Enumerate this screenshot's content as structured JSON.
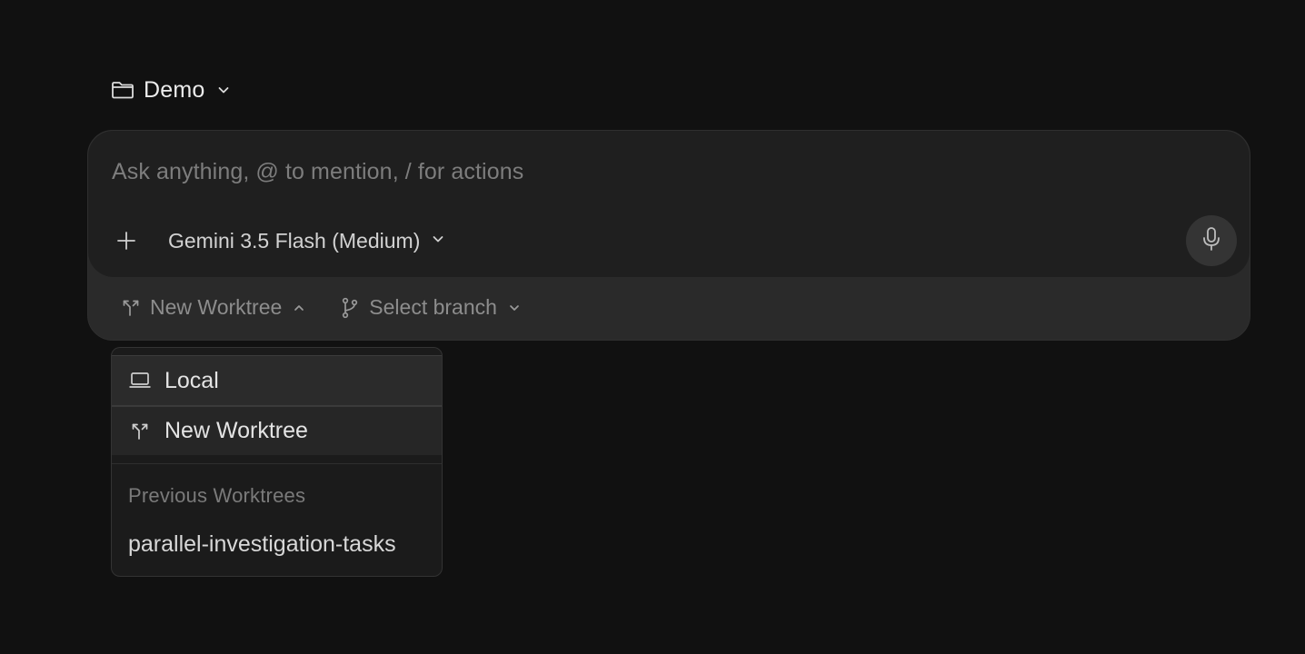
{
  "project": {
    "name": "Demo",
    "folder_icon": "folder-icon",
    "chevron_icon": "chevron-down-icon"
  },
  "composer": {
    "placeholder": "Ask anything, @ to mention, / for actions",
    "add_icon": "plus-icon",
    "model_label": "Gemini 3.5 Flash (Medium)",
    "model_chevron_icon": "chevron-down-icon",
    "mic_icon": "microphone-icon"
  },
  "workspace_bar": {
    "worktree_label": "New Worktree",
    "worktree_icon": "worktree-icon",
    "worktree_chevron_icon": "chevron-up-icon",
    "branch_label": "Select branch",
    "branch_icon": "git-branch-icon",
    "branch_chevron_icon": "chevron-down-icon"
  },
  "worktree_menu": {
    "items": [
      {
        "label": "Local",
        "icon": "laptop-icon"
      },
      {
        "label": "New Worktree",
        "icon": "worktree-icon"
      }
    ],
    "section_title": "Previous Worktrees",
    "previous": [
      {
        "label": "parallel-investigation-tasks"
      }
    ]
  },
  "colors": {
    "background": "#111111",
    "card": "#2a2a2a",
    "card_top": "#1f1f1f",
    "menu": "#1b1b1b",
    "text_primary": "#e4e4e4",
    "text_muted": "#7d7d7d"
  }
}
